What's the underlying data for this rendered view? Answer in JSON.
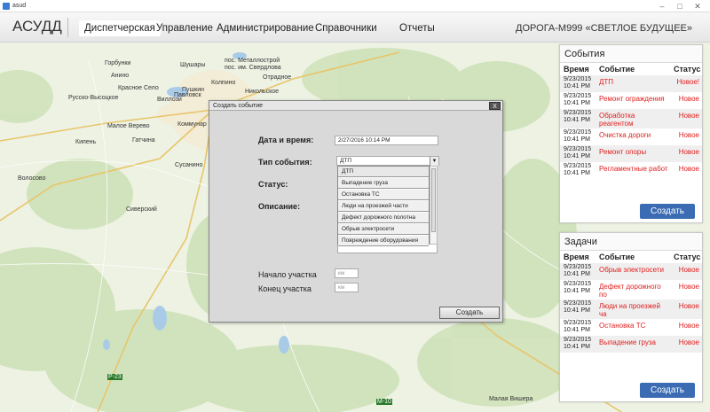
{
  "window": {
    "title": "asud",
    "controls": [
      "–",
      "□",
      "✕"
    ]
  },
  "nav": {
    "logo": "АСУДД",
    "items": [
      "Диспетчерская",
      "Управление",
      "Администрирование",
      "Справочники",
      "Отчеты"
    ],
    "active": "Диспетчерская",
    "organization": "ДОРОГА-М999 «СВЕТЛОЕ БУДУЩЕЕ»"
  },
  "map": {
    "labels": [
      "Шушары",
      "Горбунки",
      "пос. Металлострой",
      "пос. им. Свердлова",
      "Отрадное",
      "Анино",
      "Колпино",
      "Никольское",
      "Русско-Высоцкое",
      "Красное Село",
      "Павловск",
      "Пушкин",
      "Виллози",
      "Малое Верево",
      "Коммунар",
      "Гатчина",
      "Сусанино",
      "Волосово",
      "Сиверский",
      "Малая Вишера",
      "Р-23",
      "М-10",
      "Кипень"
    ]
  },
  "events": {
    "title": "События",
    "headers": [
      "Время",
      "Событие",
      "Статус"
    ],
    "rows": [
      {
        "date": "9/23/2015",
        "time": "10:41 PM",
        "event": "ДТП",
        "status": "Новое!"
      },
      {
        "date": "9/23/2015",
        "time": "10:41 PM",
        "event": "Ремонт ограждения",
        "status": "Новое"
      },
      {
        "date": "9/23/2015",
        "time": "10:41 PM",
        "event": "Обработка реагентом",
        "status": "Новое"
      },
      {
        "date": "9/23/2015",
        "time": "10:41 PM",
        "event": "Очистка дороги",
        "status": "Новое"
      },
      {
        "date": "9/23/2015",
        "time": "10:41 PM",
        "event": "Ремонт опоры",
        "status": "Новое"
      },
      {
        "date": "9/23/2015",
        "time": "10:41 PM",
        "event": "Регламентные работ",
        "status": "Новое"
      }
    ],
    "button": "Создать"
  },
  "tasks": {
    "title": "Задачи",
    "headers": [
      "Время",
      "Событие",
      "Статус"
    ],
    "rows": [
      {
        "date": "9/23/2015",
        "time": "10:41 PM",
        "event": "Обрыв электросети",
        "status": "Новое"
      },
      {
        "date": "9/23/2015",
        "time": "10:41 PM",
        "event": "Дефект дорожного по",
        "status": "Новое"
      },
      {
        "date": "9/23/2015",
        "time": "10:41 PM",
        "event": "Люди на проезжей ча",
        "status": "Новое"
      },
      {
        "date": "9/23/2015",
        "time": "10:41 PM",
        "event": "Остановка ТС",
        "status": "Новое"
      },
      {
        "date": "9/23/2015",
        "time": "10:41 PM",
        "event": "Выпадение груза",
        "status": "Новое"
      }
    ],
    "button": "Создать"
  },
  "modal": {
    "title": "Создать событие",
    "close": "X",
    "date_label": "Дата и время:",
    "date_value": "2/27/2016 10:14 PM",
    "type_label": "Тип события:",
    "type_value": "ДТП",
    "status_label": "Статус:",
    "description_label": "Описание:",
    "type_options": [
      "ДТП",
      "Выпадение груза",
      "Остановка ТС",
      "Люди на проезжей части",
      "Дефект дорожного полотна",
      "Обрыв электросети",
      "Повреждение оборудования"
    ],
    "start_label": "Начало участка",
    "start_placeholder": "км",
    "end_label": "Конец участка",
    "end_placeholder": "км",
    "submit": "Создать"
  },
  "colors": {
    "accent": "#3a6bb3",
    "status_new": "#e02020"
  }
}
